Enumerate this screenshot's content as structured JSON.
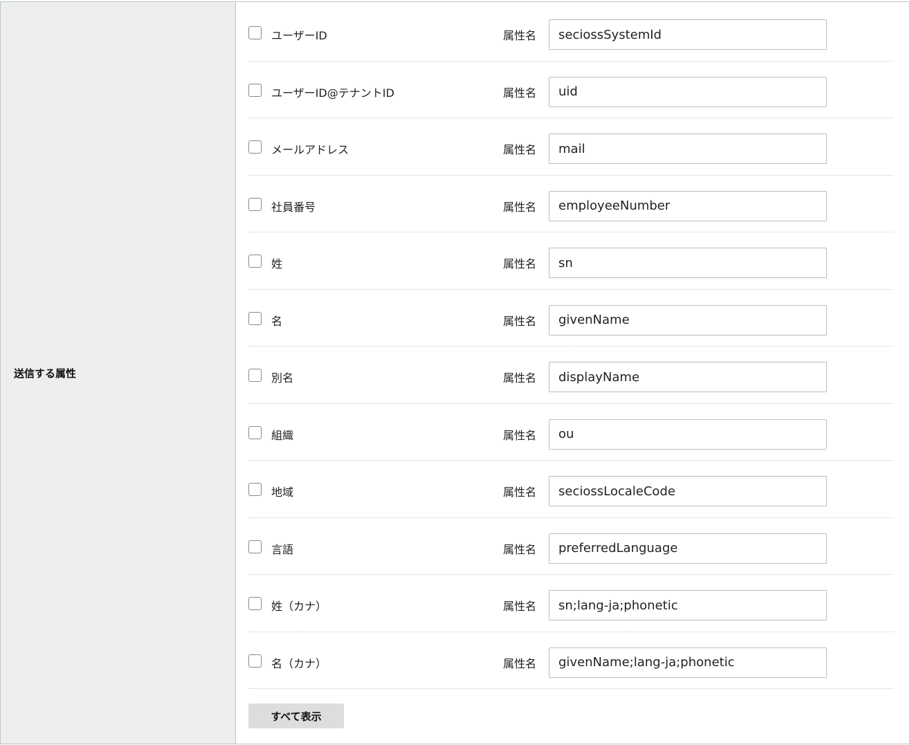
{
  "section": {
    "label": "送信する属性",
    "attr_caption": "属性名",
    "show_all_label": "すべて表示"
  },
  "rows": [
    {
      "label": "ユーザーID",
      "value": "seciossSystemId",
      "checked": false
    },
    {
      "label": "ユーザーID@テナントID",
      "value": "uid",
      "checked": false
    },
    {
      "label": "メールアドレス",
      "value": "mail",
      "checked": false
    },
    {
      "label": "社員番号",
      "value": "employeeNumber",
      "checked": false
    },
    {
      "label": "姓",
      "value": "sn",
      "checked": false
    },
    {
      "label": "名",
      "value": "givenName",
      "checked": false
    },
    {
      "label": "別名",
      "value": "displayName",
      "checked": false
    },
    {
      "label": "組織",
      "value": "ou",
      "checked": false
    },
    {
      "label": "地域",
      "value": "seciossLocaleCode",
      "checked": false
    },
    {
      "label": "言語",
      "value": "preferredLanguage",
      "checked": false
    },
    {
      "label": "姓（カナ）",
      "value": "sn;lang-ja;phonetic",
      "checked": false
    },
    {
      "label": "名（カナ）",
      "value": "givenName;lang-ja;phonetic",
      "checked": false
    }
  ]
}
